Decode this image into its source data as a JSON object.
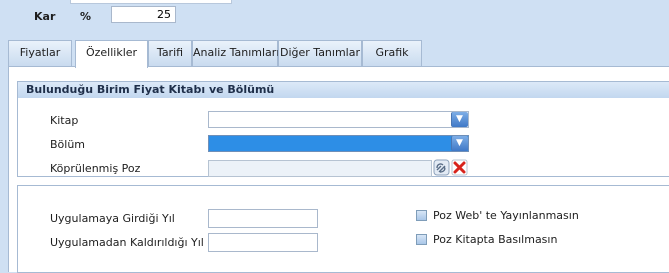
{
  "header": {
    "kar_label": "Kar",
    "percent_label": "%",
    "kar_value": "25"
  },
  "tabs": [
    {
      "label": "Fiyatlar"
    },
    {
      "label": "Özellikler",
      "active": true
    },
    {
      "label": "Tarifi"
    },
    {
      "label": "Analiz Tanımları"
    },
    {
      "label": "Diğer Tanımlar"
    },
    {
      "label": "Grafik"
    }
  ],
  "section1": {
    "title": "Bulunduğu Birim Fiyat Kitabı ve Bölümü",
    "kitap_label": "Kitap",
    "kitap_value": "",
    "bolum_label": "Bölüm",
    "bolum_value": "",
    "poz_label": "Köprülenmiş Poz",
    "poz_value": ""
  },
  "section2": {
    "girdi_label": "Uygulamaya Girdiği Yıl",
    "girdi_value": "",
    "kaldirildi_label": "Uygulamadan Kaldırıldığı Yıl",
    "kaldirildi_value": "",
    "web_checkbox_label": "Poz Web' te Yayınlanmasın",
    "web_checked": false,
    "kitap_checkbox_label": "Poz Kitapta Basılmasın",
    "kitap_checked": false
  },
  "icons": {
    "dropdown": "chevron-down-icon",
    "link": "link-icon",
    "delete": "delete-icon"
  },
  "colors": {
    "background": "#cfe0f3",
    "selection": "#2d8ee6",
    "delete_red": "#d8241c"
  }
}
